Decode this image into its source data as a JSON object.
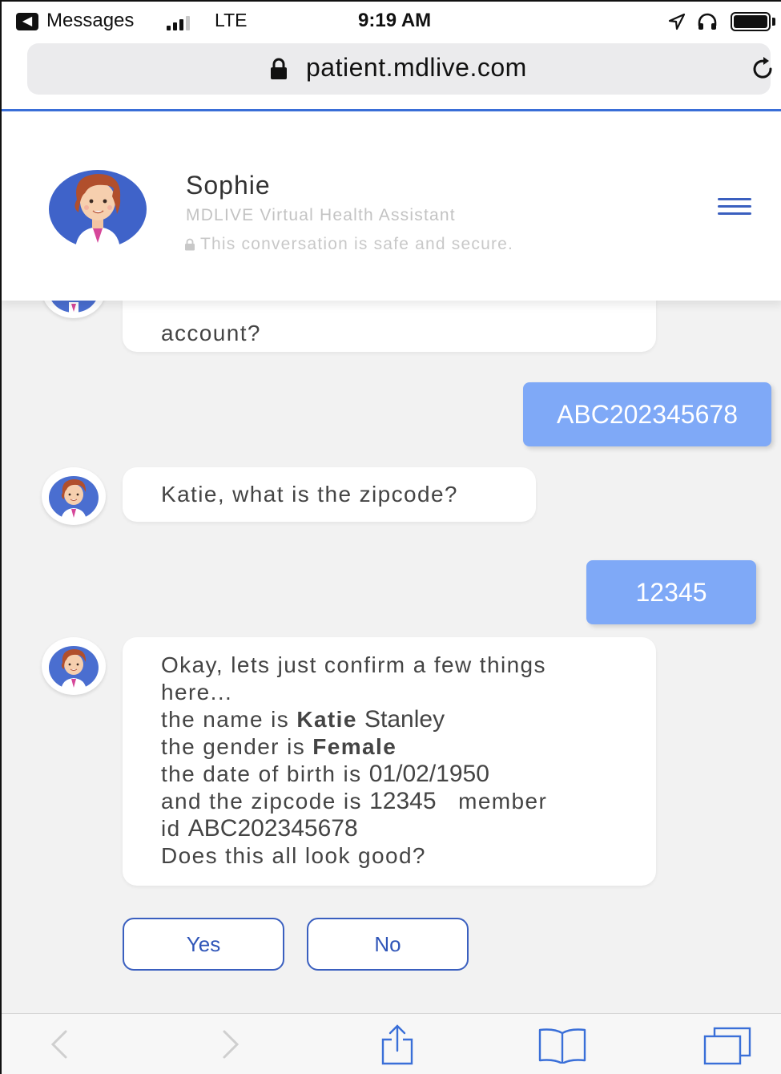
{
  "status_bar": {
    "back_label": "Messages",
    "network": "LTE",
    "time": "9:19 AM"
  },
  "browser": {
    "url": "patient.mdlive.com"
  },
  "chat_header": {
    "name": "Sophie",
    "subtitle": "MDLIVE Virtual Health Assistant",
    "secure_note": "This conversation is safe and secure."
  },
  "messages": [
    {
      "from": "bot",
      "text": "What's the member id on the account?",
      "visible_text": "account?"
    },
    {
      "from": "user",
      "text": "ABC202345678"
    },
    {
      "from": "bot",
      "text": "Katie, what is the zipcode?"
    },
    {
      "from": "user",
      "text": "12345"
    },
    {
      "from": "bot",
      "lines": {
        "intro1": "Okay, lets just confirm a few things",
        "intro2": "here...",
        "name_prefix": "the name is",
        "first_name": "Katie",
        "last_name": "Stanley",
        "gender_prefix": "the gender is",
        "gender": "Female",
        "dob_prefix": "the date of birth is",
        "dob": "01/02/1950",
        "zip_prefix": "and the zipcode is",
        "zip": "12345",
        "member_word": "member",
        "id_word": "id",
        "member_id": "ABC202345678",
        "question": "Does this all look good?"
      }
    }
  ],
  "choices": {
    "yes": "Yes",
    "no": "No"
  },
  "colors": {
    "accent": "#3a5fbf",
    "user_bubble": "#7fa9f7",
    "chat_background": "#f2f2f2",
    "progress": "#3a6fd8"
  }
}
